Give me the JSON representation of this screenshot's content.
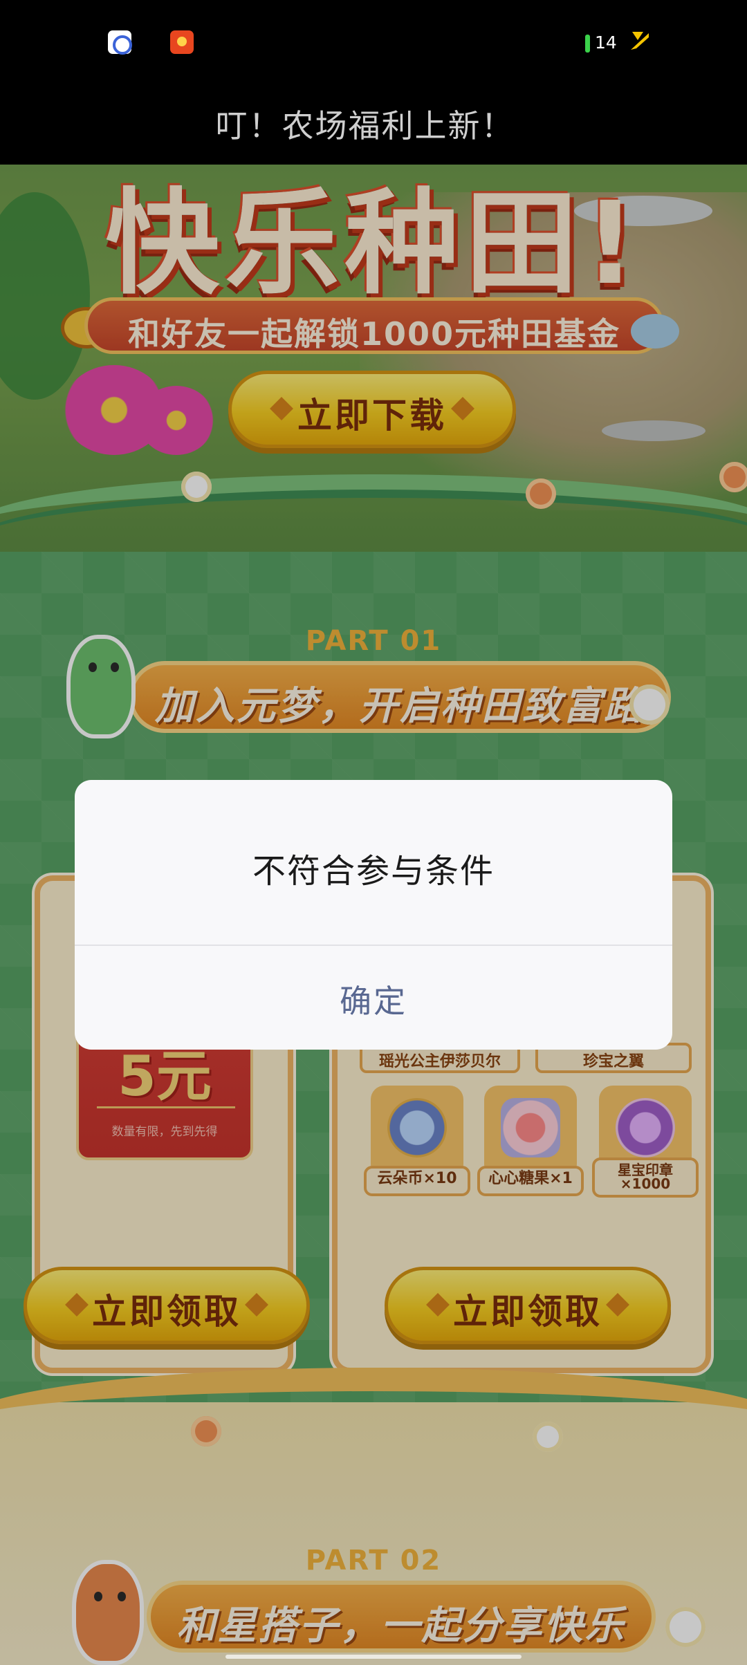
{
  "status_bar": {
    "battery_level": "14",
    "apps": [
      "browser-app-icon",
      "news-app-icon"
    ]
  },
  "header": {
    "title": "叮！农场福利上新！"
  },
  "hero": {
    "title": "快乐种田!",
    "subtitle": "和好友一起解锁1000元种田基金",
    "download_button": "立即下载"
  },
  "part1": {
    "label": "PART 01",
    "banner": "加入元梦，开启种田致富路",
    "coupon": {
      "value": "5元",
      "note": "数量有限，先到先得"
    },
    "reward_tags": [
      "瑶光公主伊莎贝尔",
      "珍宝之翼"
    ],
    "items": [
      {
        "name": "云朵币×10",
        "icon": "cloud-coin-icon"
      },
      {
        "name": "心心糖果×1",
        "icon": "heart-candy-icon"
      },
      {
        "name": "星宝印章\n×1000",
        "icon": "star-stamp-icon"
      }
    ],
    "claim_button_left": "立即领取",
    "claim_button_right": "立即领取"
  },
  "part2": {
    "label": "PART 02",
    "banner": "和星搭子，一起分享快乐"
  },
  "dialog": {
    "message": "不符合参与条件",
    "confirm_button": "确定"
  },
  "colors": {
    "dialog_button": "#596891",
    "button_yellow": "#f8cf22",
    "banner_orange": "#e58a25",
    "background_green": "#58a264"
  }
}
